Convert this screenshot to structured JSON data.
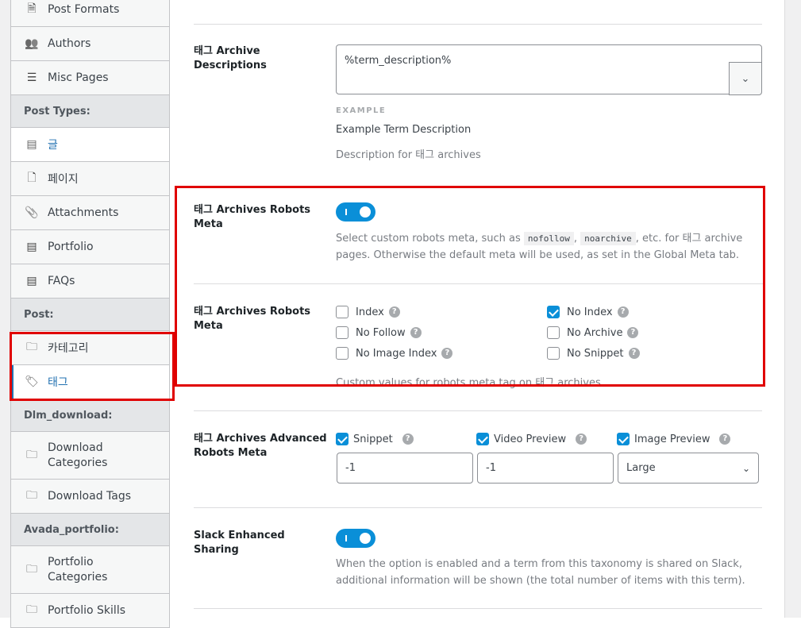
{
  "sidebar": {
    "items": [
      {
        "type": "item",
        "label": "Post Formats",
        "icon": "post-format-icon"
      },
      {
        "type": "item",
        "label": "Authors",
        "icon": "users-icon"
      },
      {
        "type": "item",
        "label": "Misc Pages",
        "icon": "list-circle-icon"
      },
      {
        "type": "head",
        "label": "Post Types:"
      },
      {
        "type": "item",
        "label": "글",
        "icon": "document-icon"
      },
      {
        "type": "item",
        "label": "페이지",
        "icon": "page-icon"
      },
      {
        "type": "item",
        "label": "Attachments",
        "icon": "paperclip-icon"
      },
      {
        "type": "item",
        "label": "Portfolio",
        "icon": "document-icon"
      },
      {
        "type": "item",
        "label": "FAQs",
        "icon": "document-icon"
      },
      {
        "type": "head",
        "label": "Post:"
      },
      {
        "type": "item",
        "label": "카테고리",
        "icon": "folder-icon"
      },
      {
        "type": "item",
        "label": "태그",
        "icon": "tag-icon"
      },
      {
        "type": "head",
        "label": "Dlm_download:"
      },
      {
        "type": "item",
        "label": "Download Categories",
        "icon": "folder-icon"
      },
      {
        "type": "item",
        "label": "Download Tags",
        "icon": "folder-icon"
      },
      {
        "type": "head",
        "label": "Avada_portfolio:"
      },
      {
        "type": "item",
        "label": "Portfolio Categories",
        "icon": "folder-icon"
      },
      {
        "type": "item",
        "label": "Portfolio Skills",
        "icon": "folder-icon"
      }
    ]
  },
  "archive_desc": {
    "label": "태그 Archive Descriptions",
    "value": "%term_description%",
    "example_heading": "EXAMPLE",
    "example": "Example Term Description",
    "help": "Description for 태그 archives"
  },
  "robots_toggle": {
    "label": "태그 Archives Robots Meta",
    "enabled": true,
    "help_pre": "Select custom robots meta, such as ",
    "code1": "nofollow",
    "sep": ", ",
    "code2": "noarchive",
    "help_post": ", etc. for 태그 archive pages. Otherwise the default meta will be used, as set in the Global Meta tab."
  },
  "robots_meta": {
    "label": "태그 Archives Robots Meta",
    "options": [
      {
        "label": "Index",
        "checked": false
      },
      {
        "label": "No Index",
        "checked": true
      },
      {
        "label": "No Follow",
        "checked": false
      },
      {
        "label": "No Archive",
        "checked": false
      },
      {
        "label": "No Image Index",
        "checked": false
      },
      {
        "label": "No Snippet",
        "checked": false
      }
    ],
    "help": "Custom values for robots meta tag on 태그 archives."
  },
  "advanced": {
    "label": "태그 Archives Advanced Robots Meta",
    "snippet": {
      "label": "Snippet",
      "checked": true,
      "value": "-1"
    },
    "video": {
      "label": "Video Preview",
      "checked": true,
      "value": "-1"
    },
    "image": {
      "label": "Image Preview",
      "checked": true,
      "value": "Large"
    }
  },
  "slack": {
    "label": "Slack Enhanced Sharing",
    "enabled": true,
    "help": "When the option is enabled and a term from this taxonomy is shared on Slack, additional information will be shown (the total number of items with this term)."
  },
  "colors": {
    "accent": "#0a8fd8",
    "highlight": "#e00000"
  }
}
